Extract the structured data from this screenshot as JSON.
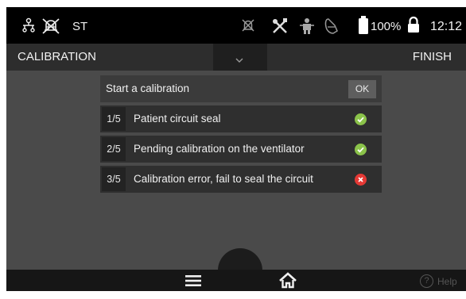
{
  "status_bar": {
    "mode": "ST",
    "battery": "100%",
    "time": "12:12",
    "icons": [
      "patient-circuit-icon",
      "alarm-silenced-icon",
      "alarm-off-icon",
      "tools-icon",
      "patient-icon",
      "mask-icon",
      "battery-icon",
      "lock-icon"
    ]
  },
  "title_bar": {
    "title": "CALIBRATION",
    "finish_label": "FINISH",
    "expand_icon": "chevron-down-icon"
  },
  "panel": {
    "header": "Start a calibration",
    "ok_label": "OK",
    "steps": [
      {
        "num": "1/5",
        "label": "Patient circuit seal",
        "status": "ok"
      },
      {
        "num": "2/5",
        "label": "Pending calibration on the ventilator",
        "status": "ok"
      },
      {
        "num": "3/5",
        "label": "Calibration error, fail to seal the circuit",
        "status": "error"
      }
    ]
  },
  "bottom_bar": {
    "help_label": "Help",
    "help_icon_glyph": "?",
    "menu_icon": "hamburger-menu-icon",
    "home_icon": "home-icon"
  },
  "colors": {
    "ok": "#8bc34a",
    "error": "#e53935",
    "background": "#4a4a4a"
  }
}
